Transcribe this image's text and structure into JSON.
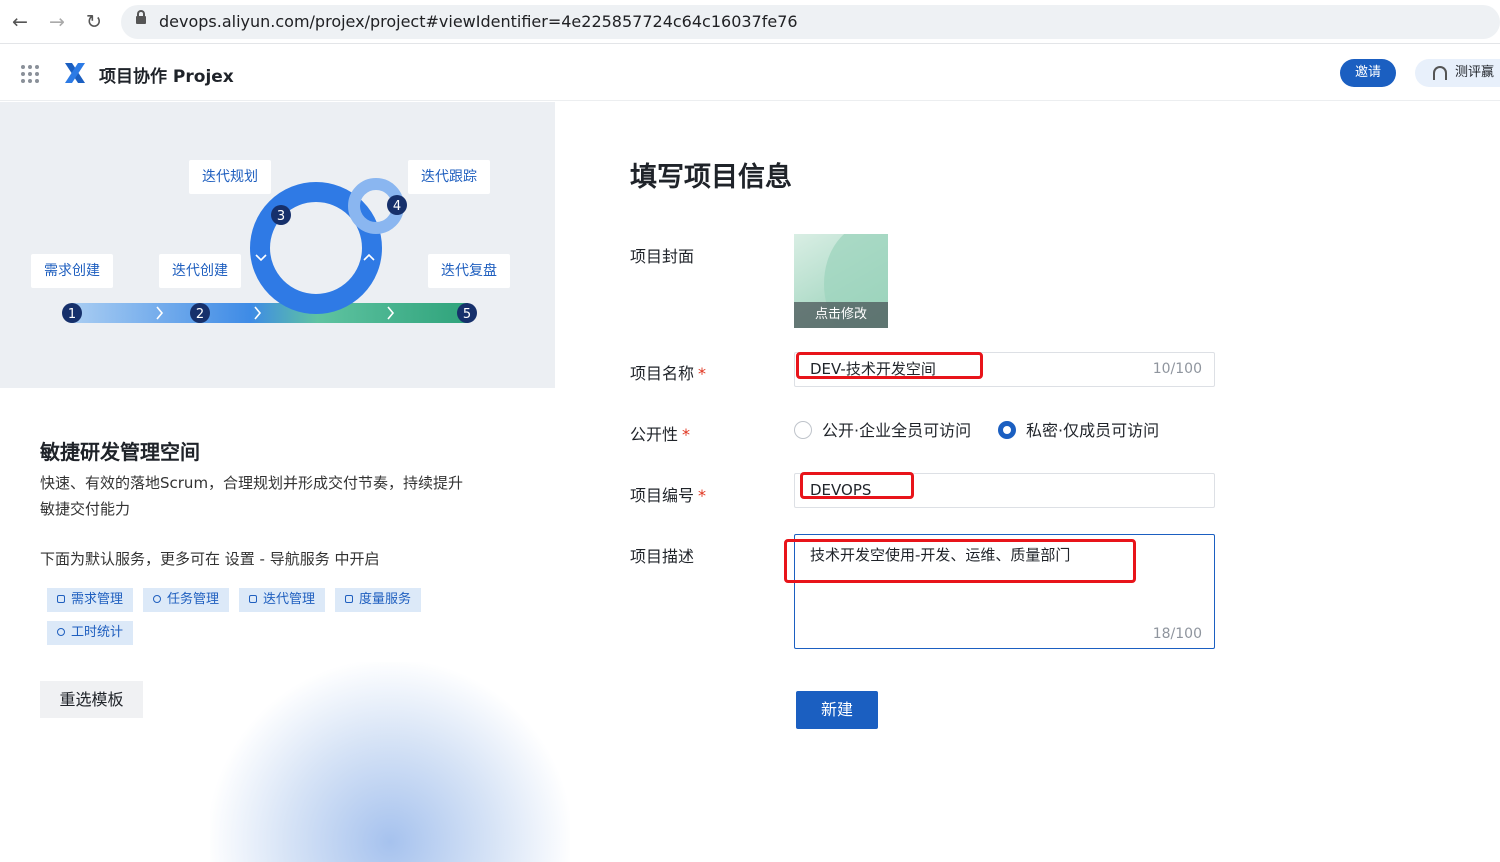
{
  "browser": {
    "url": "devops.aliyun.com/projex/project#viewIdentifier=4e225857724c64c16037fe76",
    "back_icon": "←",
    "forward_icon": "→",
    "reload_icon": "↻"
  },
  "header": {
    "app_name": "项目协作 Projex",
    "invite_label": "邀请",
    "eval_label": "测评赢"
  },
  "hero": {
    "steps": [
      {
        "label": "需求创建",
        "num": "1"
      },
      {
        "label": "迭代创建",
        "num": "2"
      },
      {
        "label": "迭代规划",
        "num": "3"
      },
      {
        "label": "迭代跟踪",
        "num": "4"
      },
      {
        "label": "迭代复盘",
        "num": "5"
      }
    ]
  },
  "template_info": {
    "title": "敏捷研发管理空间",
    "description": "快速、有效的落地Scrum，合理规划并形成交付节奏，持续提升敏捷交付能力",
    "note": "下面为默认服务，更多可在 设置 - 导航服务 中开启",
    "services": [
      "需求管理",
      "任务管理",
      "迭代管理",
      "度量服务",
      "工时统计"
    ],
    "reselect_label": "重选模板"
  },
  "form": {
    "title": "填写项目信息",
    "cover_label": "项目封面",
    "cover_action": "点击修改",
    "name_label": "项目名称",
    "name_value": "DEV-技术开发空间",
    "name_count": "10/100",
    "visibility_label": "公开性",
    "visibility_options": [
      "公开·企业全员可访问",
      "私密·仅成员可访问"
    ],
    "visibility_selected": 1,
    "code_label": "项目编号",
    "code_value": "DEVOPS",
    "desc_label": "项目描述",
    "desc_value": "技术开发空使用-开发、运维、质量部门",
    "desc_count": "18/100",
    "required_mark": "*",
    "submit_label": "新建"
  },
  "colors": {
    "primary": "#1b5fc1",
    "annotation": "#e8141a",
    "required": "#e0341e"
  }
}
